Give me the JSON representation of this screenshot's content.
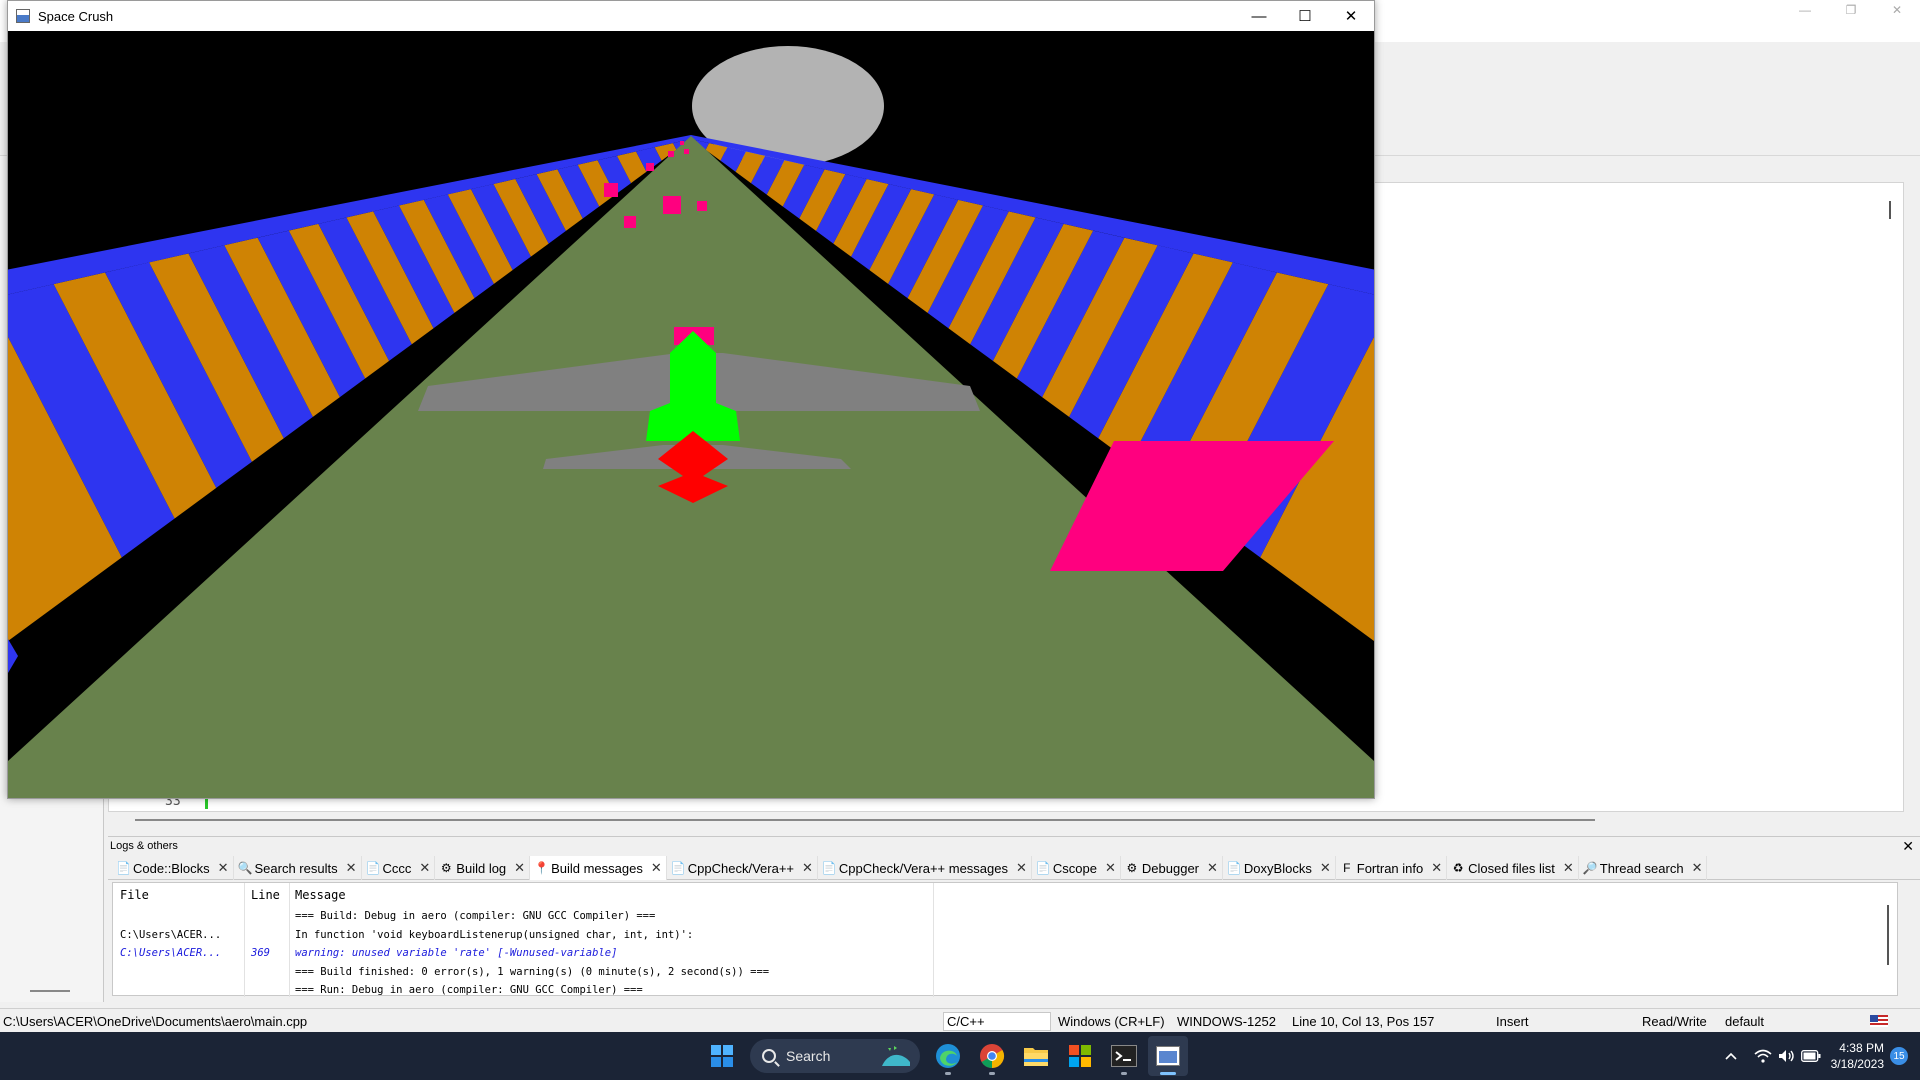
{
  "ide": {
    "window_buttons": [
      "—",
      "❐",
      "✕"
    ],
    "editor": {
      "line_number": "33"
    },
    "logs": {
      "title": "Logs & others",
      "close": "✕",
      "tabs": [
        {
          "label": "Code::Blocks",
          "icon": "document-icon",
          "glyph": "📄",
          "active": false
        },
        {
          "label": "Search results",
          "icon": "search-icon",
          "glyph": "🔍",
          "active": false
        },
        {
          "label": "Cccc",
          "icon": "document-icon",
          "glyph": "📄",
          "active": false
        },
        {
          "label": "Build log",
          "icon": "gear-icon",
          "glyph": "⚙",
          "active": false
        },
        {
          "label": "Build messages",
          "icon": "pin-icon",
          "glyph": "📍",
          "active": true
        },
        {
          "label": "CppCheck/Vera++",
          "icon": "document-icon",
          "glyph": "📄",
          "active": false
        },
        {
          "label": "CppCheck/Vera++ messages",
          "icon": "document-icon",
          "glyph": "📄",
          "active": false
        },
        {
          "label": "Cscope",
          "icon": "document-icon",
          "glyph": "📄",
          "active": false
        },
        {
          "label": "Debugger",
          "icon": "gear-icon",
          "glyph": "⚙",
          "active": false
        },
        {
          "label": "DoxyBlocks",
          "icon": "document-icon",
          "glyph": "📄",
          "active": false
        },
        {
          "label": "Fortran info",
          "icon": "fortran-icon",
          "glyph": "F",
          "active": false
        },
        {
          "label": "Closed files list",
          "icon": "recycle-icon",
          "glyph": "♻",
          "active": false
        },
        {
          "label": "Thread search",
          "icon": "thread-search-icon",
          "glyph": "🔎",
          "active": false
        }
      ],
      "columns": {
        "file": "File",
        "line": "Line",
        "message": "Message"
      },
      "rows": [
        {
          "file": "",
          "line": "",
          "message": "=== Build: Debug in aero (compiler: GNU GCC Compiler) ===",
          "type": "info"
        },
        {
          "file": "C:\\Users\\ACER...",
          "line": "",
          "message": "In function 'void keyboardListenerup(unsigned char, int, int)':",
          "type": "info"
        },
        {
          "file": "C:\\Users\\ACER...",
          "line": "369",
          "message": "warning: unused variable 'rate' [-Wunused-variable]",
          "type": "warning"
        },
        {
          "file": "",
          "line": "",
          "message": "=== Build finished: 0 error(s), 1 warning(s) (0 minute(s), 2 second(s)) ===",
          "type": "info"
        },
        {
          "file": "",
          "line": "",
          "message": "=== Run: Debug in aero (compiler: GNU GCC Compiler) ===",
          "type": "info"
        }
      ]
    },
    "status_bar": {
      "path": "C:\\Users\\ACER\\OneDrive\\Documents\\aero\\main.cpp",
      "language": "C/C++",
      "eol": "Windows (CR+LF)",
      "encoding": "WINDOWS-1252",
      "position": "Line 10, Col 13, Pos 157",
      "mode": "Insert",
      "access": "Read/Write",
      "profile": "default"
    }
  },
  "game": {
    "title": "Space Crush",
    "buttons": {
      "minimize": "—",
      "maximize": "☐",
      "close": "✕"
    },
    "colors": {
      "sky": "#000000",
      "moon": "#b3b3b3",
      "road": "#68824c",
      "wall_blue": "#2e35f0",
      "wall_orange": "#cf8304",
      "obstacle": "#ff007f",
      "plane_body": "#00ff00",
      "plane_wings": "#808080",
      "plane_flame": "#ff0000"
    }
  },
  "taskbar": {
    "search_label": "Search",
    "clock_time": "4:38 PM",
    "clock_date": "3/18/2023",
    "notification_count": "15",
    "apps": [
      {
        "name": "start",
        "icon": "windows-start-icon"
      },
      {
        "name": "edge",
        "icon": "edge-browser-icon"
      },
      {
        "name": "chrome",
        "icon": "chrome-browser-icon"
      },
      {
        "name": "explorer",
        "icon": "file-explorer-icon"
      },
      {
        "name": "store",
        "icon": "microsoft-store-icon"
      },
      {
        "name": "terminal",
        "icon": "terminal-icon"
      },
      {
        "name": "game-app",
        "icon": "game-app-icon"
      }
    ]
  }
}
